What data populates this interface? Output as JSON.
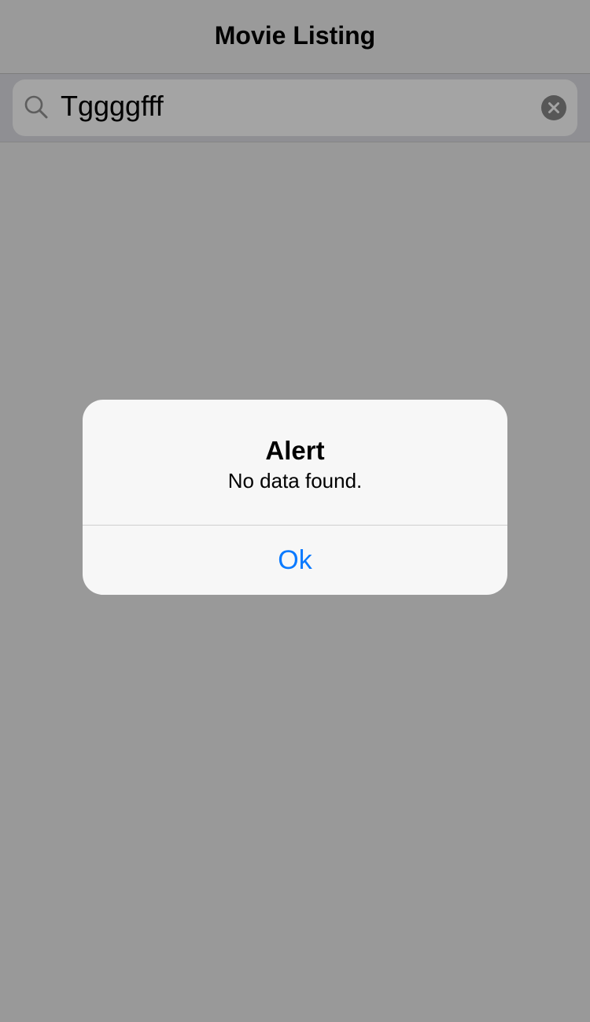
{
  "nav": {
    "title": "Movie Listing"
  },
  "search": {
    "value": "Tggggfff",
    "icon": "search-icon",
    "clear_icon": "clear-icon"
  },
  "alert": {
    "title": "Alert",
    "message": "No data found.",
    "ok_label": "Ok"
  },
  "colors": {
    "accent": "#0a7aff",
    "overlay": "#999999"
  }
}
